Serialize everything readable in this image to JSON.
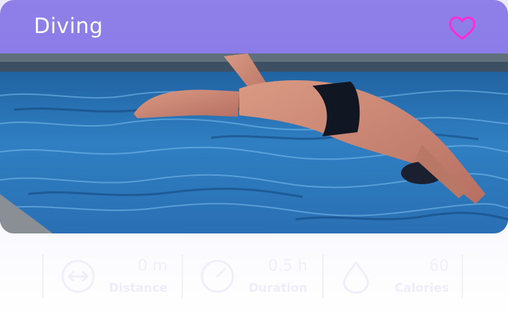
{
  "header": {
    "title": "Diving"
  },
  "colors": {
    "accent": "#ff2bd6",
    "header_bg": "#8f7fe8"
  },
  "icons": {
    "favorite": "heart-icon",
    "distance": "arrows-horizontal-icon",
    "duration": "gauge-icon",
    "calories": "drop-icon"
  },
  "image": {
    "subject": "diver-jumping-into-pool"
  },
  "stats": [
    {
      "value": "0 m",
      "label": "Distance"
    },
    {
      "value": "0.5 h",
      "label": "Duration"
    },
    {
      "value": "60",
      "label": "Calories"
    }
  ]
}
